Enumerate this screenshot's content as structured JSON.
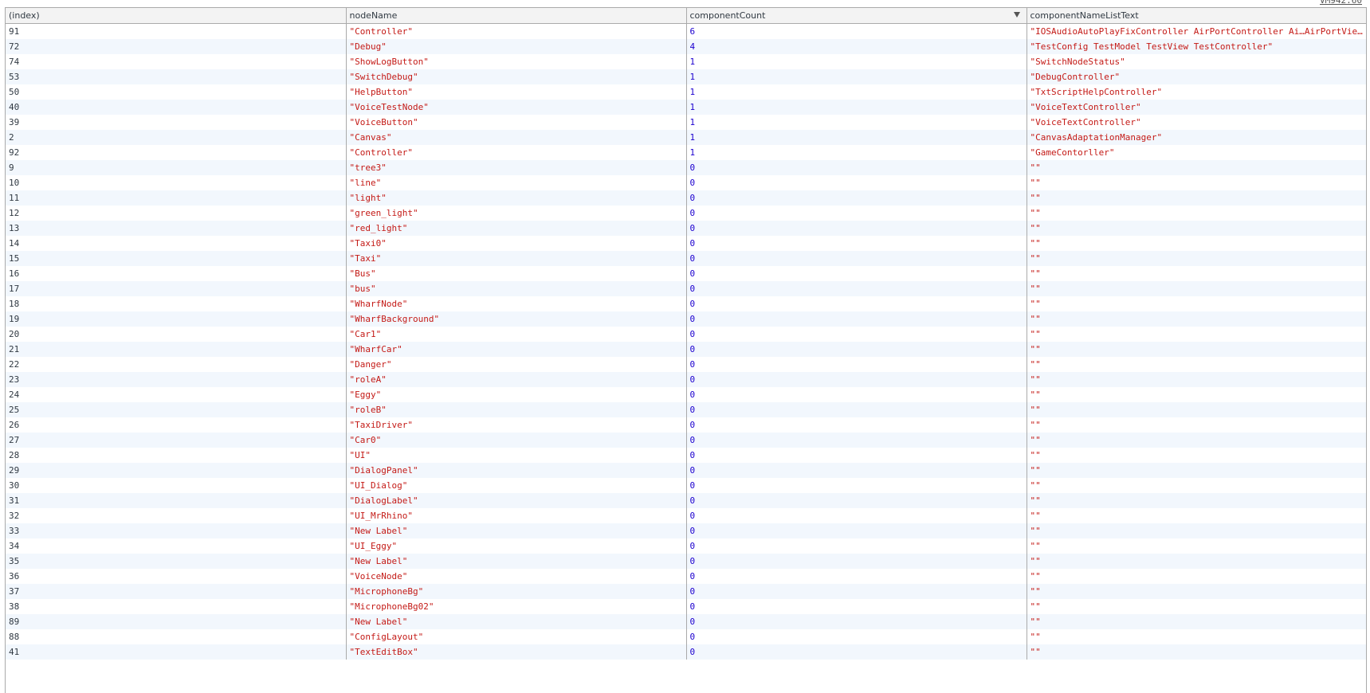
{
  "console": {
    "source_link": "VM942:60"
  },
  "table": {
    "headers": {
      "index": "(index)",
      "nodeName": "nodeName",
      "componentCount": "componentCount",
      "componentNameListText": "componentNameListText"
    },
    "sorted_column": "componentCount",
    "sort_direction": "descending",
    "colors": {
      "string": "#c41a16",
      "number": "#1c00cf",
      "stripe": "#f2f7fd",
      "header_bg": "#f3f3f3",
      "border": "#aaaaaa"
    },
    "rows": [
      {
        "index": "91",
        "nodeName": "\"Controller\"",
        "componentCount": "6",
        "componentNameListText": "\"IOSAudioAutoPlayFixController AirPortController Ai…AirPortVie…"
      },
      {
        "index": "72",
        "nodeName": "\"Debug\"",
        "componentCount": "4",
        "componentNameListText": "\"TestConfig TestModel TestView TestController\""
      },
      {
        "index": "74",
        "nodeName": "\"ShowLogButton\"",
        "componentCount": "1",
        "componentNameListText": "\"SwitchNodeStatus\""
      },
      {
        "index": "53",
        "nodeName": "\"SwitchDebug\"",
        "componentCount": "1",
        "componentNameListText": "\"DebugController\""
      },
      {
        "index": "50",
        "nodeName": "\"HelpButton\"",
        "componentCount": "1",
        "componentNameListText": "\"TxtScriptHelpController\""
      },
      {
        "index": "40",
        "nodeName": "\"VoiceTestNode\"",
        "componentCount": "1",
        "componentNameListText": "\"VoiceTextController\""
      },
      {
        "index": "39",
        "nodeName": "\"VoiceButton\"",
        "componentCount": "1",
        "componentNameListText": "\"VoiceTextController\""
      },
      {
        "index": "2",
        "nodeName": "\"Canvas\"",
        "componentCount": "1",
        "componentNameListText": "\"CanvasAdaptationManager\""
      },
      {
        "index": "92",
        "nodeName": "\"Controller\"",
        "componentCount": "1",
        "componentNameListText": "\"GameContorller\""
      },
      {
        "index": "9",
        "nodeName": "\"tree3\"",
        "componentCount": "0",
        "componentNameListText": "\"\""
      },
      {
        "index": "10",
        "nodeName": "\"line\"",
        "componentCount": "0",
        "componentNameListText": "\"\""
      },
      {
        "index": "11",
        "nodeName": "\"light\"",
        "componentCount": "0",
        "componentNameListText": "\"\""
      },
      {
        "index": "12",
        "nodeName": "\"green_light\"",
        "componentCount": "0",
        "componentNameListText": "\"\""
      },
      {
        "index": "13",
        "nodeName": "\"red_light\"",
        "componentCount": "0",
        "componentNameListText": "\"\""
      },
      {
        "index": "14",
        "nodeName": "\"Taxi0\"",
        "componentCount": "0",
        "componentNameListText": "\"\""
      },
      {
        "index": "15",
        "nodeName": "\"Taxi\"",
        "componentCount": "0",
        "componentNameListText": "\"\""
      },
      {
        "index": "16",
        "nodeName": "\"Bus\"",
        "componentCount": "0",
        "componentNameListText": "\"\""
      },
      {
        "index": "17",
        "nodeName": "\"bus\"",
        "componentCount": "0",
        "componentNameListText": "\"\""
      },
      {
        "index": "18",
        "nodeName": "\"WharfNode\"",
        "componentCount": "0",
        "componentNameListText": "\"\""
      },
      {
        "index": "19",
        "nodeName": "\"WharfBackground\"",
        "componentCount": "0",
        "componentNameListText": "\"\""
      },
      {
        "index": "20",
        "nodeName": "\"Car1\"",
        "componentCount": "0",
        "componentNameListText": "\"\""
      },
      {
        "index": "21",
        "nodeName": "\"WharfCar\"",
        "componentCount": "0",
        "componentNameListText": "\"\""
      },
      {
        "index": "22",
        "nodeName": "\"Danger\"",
        "componentCount": "0",
        "componentNameListText": "\"\""
      },
      {
        "index": "23",
        "nodeName": "\"roleA\"",
        "componentCount": "0",
        "componentNameListText": "\"\""
      },
      {
        "index": "24",
        "nodeName": "\"Eggy\"",
        "componentCount": "0",
        "componentNameListText": "\"\""
      },
      {
        "index": "25",
        "nodeName": "\"roleB\"",
        "componentCount": "0",
        "componentNameListText": "\"\""
      },
      {
        "index": "26",
        "nodeName": "\"TaxiDriver\"",
        "componentCount": "0",
        "componentNameListText": "\"\""
      },
      {
        "index": "27",
        "nodeName": "\"Car0\"",
        "componentCount": "0",
        "componentNameListText": "\"\""
      },
      {
        "index": "28",
        "nodeName": "\"UI\"",
        "componentCount": "0",
        "componentNameListText": "\"\""
      },
      {
        "index": "29",
        "nodeName": "\"DialogPanel\"",
        "componentCount": "0",
        "componentNameListText": "\"\""
      },
      {
        "index": "30",
        "nodeName": "\"UI_Dialog\"",
        "componentCount": "0",
        "componentNameListText": "\"\""
      },
      {
        "index": "31",
        "nodeName": "\"DialogLabel\"",
        "componentCount": "0",
        "componentNameListText": "\"\""
      },
      {
        "index": "32",
        "nodeName": "\"UI_MrRhino\"",
        "componentCount": "0",
        "componentNameListText": "\"\""
      },
      {
        "index": "33",
        "nodeName": "\"New Label\"",
        "componentCount": "0",
        "componentNameListText": "\"\""
      },
      {
        "index": "34",
        "nodeName": "\"UI_Eggy\"",
        "componentCount": "0",
        "componentNameListText": "\"\""
      },
      {
        "index": "35",
        "nodeName": "\"New Label\"",
        "componentCount": "0",
        "componentNameListText": "\"\""
      },
      {
        "index": "36",
        "nodeName": "\"VoiceNode\"",
        "componentCount": "0",
        "componentNameListText": "\"\""
      },
      {
        "index": "37",
        "nodeName": "\"MicrophoneBg\"",
        "componentCount": "0",
        "componentNameListText": "\"\""
      },
      {
        "index": "38",
        "nodeName": "\"MicrophoneBg02\"",
        "componentCount": "0",
        "componentNameListText": "\"\""
      },
      {
        "index": "89",
        "nodeName": "\"New Label\"",
        "componentCount": "0",
        "componentNameListText": "\"\""
      },
      {
        "index": "88",
        "nodeName": "\"ConfigLayout\"",
        "componentCount": "0",
        "componentNameListText": "\"\""
      },
      {
        "index": "41",
        "nodeName": "\"TextEditBox\"",
        "componentCount": "0",
        "componentNameListText": "\"\""
      }
    ]
  }
}
